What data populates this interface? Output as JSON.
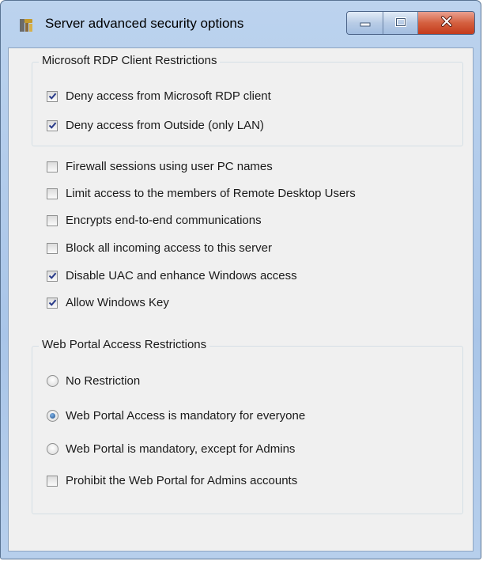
{
  "window": {
    "title": "Server advanced security options"
  },
  "rdp_group": {
    "legend": "Microsoft RDP Client Restrictions",
    "items": [
      {
        "label": "Deny access from Microsoft RDP client",
        "checked": true
      },
      {
        "label": "Deny access from Outside (only LAN)",
        "checked": true
      }
    ]
  },
  "options": [
    {
      "label": "Firewall sessions using user PC names",
      "checked": false
    },
    {
      "label": "Limit access to the members of Remote Desktop Users",
      "checked": false
    },
    {
      "label": "Encrypts end-to-end communications",
      "checked": false
    },
    {
      "label": "Block all incoming access to this server",
      "checked": false
    },
    {
      "label": "Disable UAC and enhance Windows access",
      "checked": true
    },
    {
      "label": "Allow Windows Key",
      "checked": true
    }
  ],
  "web_group": {
    "legend": "Web Portal Access Restrictions",
    "radios": [
      {
        "label": "No Restriction",
        "selected": false
      },
      {
        "label": "Web Portal Access is mandatory for everyone",
        "selected": true
      },
      {
        "label": "Web Portal is mandatory, except for Admins",
        "selected": false
      }
    ],
    "checkbox": {
      "label": "Prohibit the Web Portal for Admins accounts",
      "checked": false
    }
  },
  "icons": {
    "app": "tools-icon",
    "minimize": "minimize-icon",
    "maximize": "maximize-icon",
    "close": "close-icon",
    "check": "check-icon"
  },
  "colors": {
    "title_bar": "#b9d1ee",
    "close_button": "#c9452a",
    "client_bg": "#f0f0f0"
  }
}
